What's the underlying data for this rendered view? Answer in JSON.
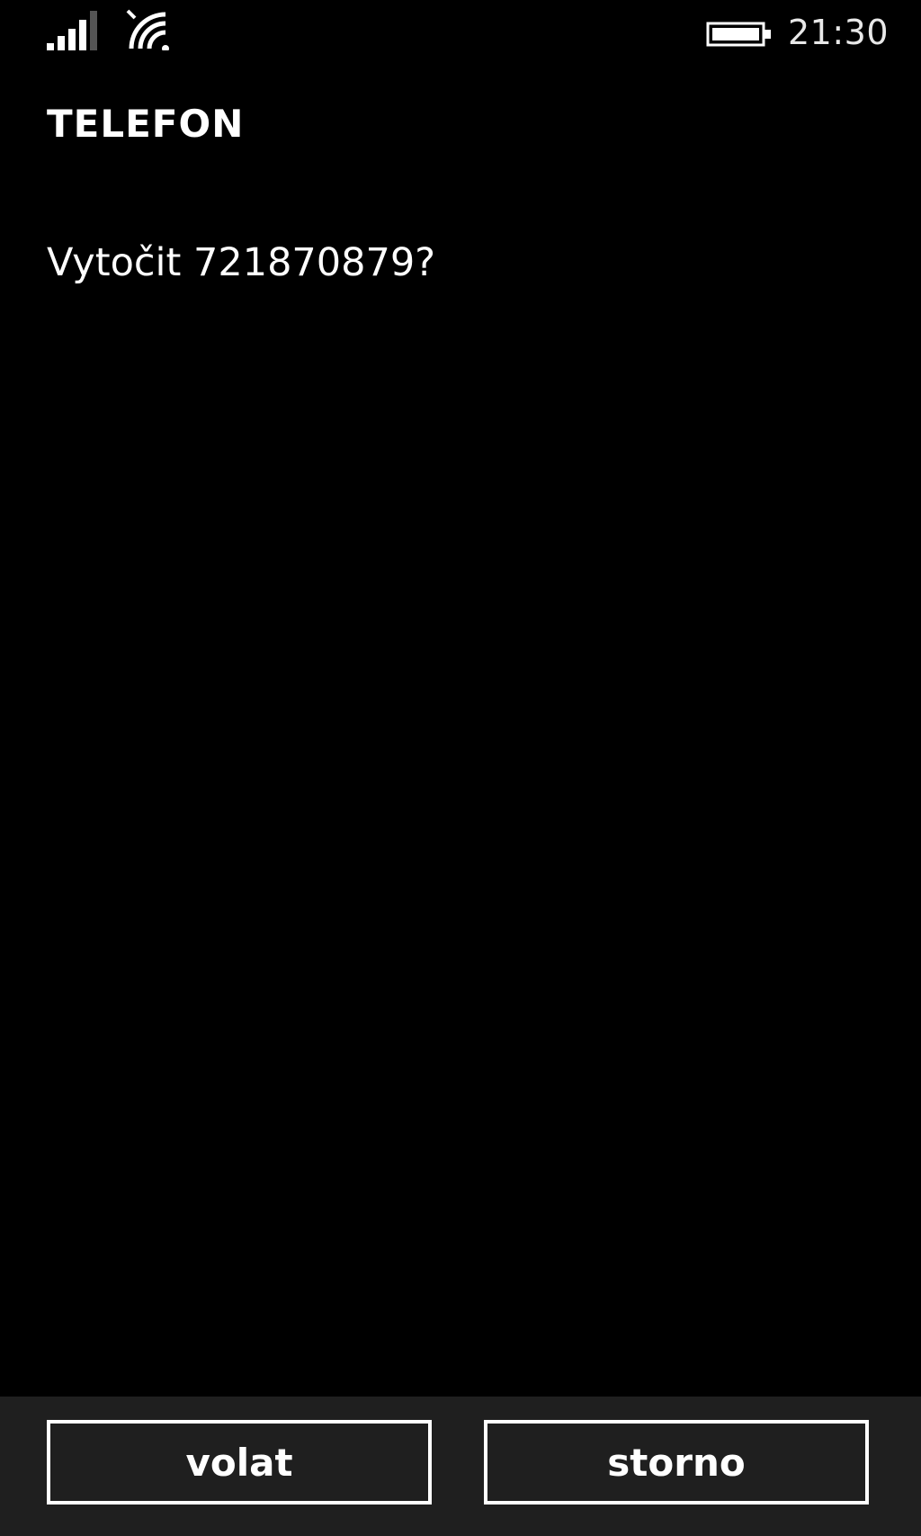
{
  "status_bar": {
    "signal_icon": "signal-strength-icon",
    "wifi_icon": "wifi-icon",
    "battery_icon": "battery-icon",
    "time": "21:30"
  },
  "app": {
    "title": "TELEFON"
  },
  "dialog": {
    "prompt": "Vytočit 721870879?"
  },
  "app_bar": {
    "call_label": "volat",
    "cancel_label": "storno"
  },
  "colors": {
    "background": "#000000",
    "app_bar": "#1f1f1f",
    "foreground": "#ffffff"
  }
}
